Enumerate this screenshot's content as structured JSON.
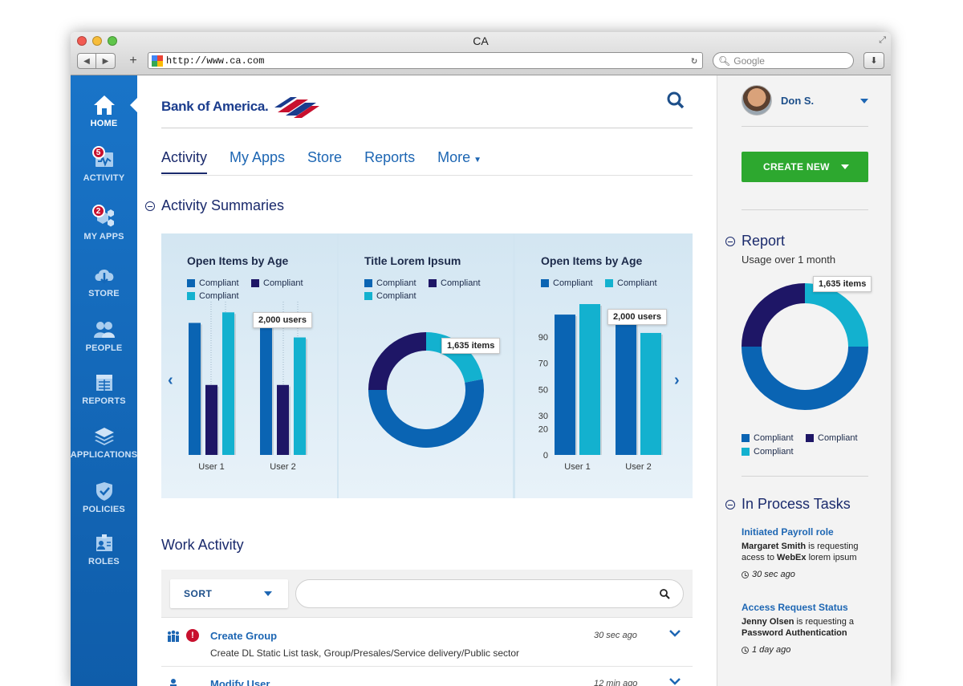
{
  "browser": {
    "window_title": "CA",
    "url": "http://www.ca.com",
    "search_placeholder": "Google"
  },
  "sidebar": {
    "items": [
      {
        "label": "HOME",
        "icon": "home-icon"
      },
      {
        "label": "ACTIVITY",
        "icon": "activity-icon",
        "badge": "5"
      },
      {
        "label": "MY APPS",
        "icon": "apps-icon",
        "badge": "2"
      },
      {
        "label": "STORE",
        "icon": "store-icon"
      },
      {
        "label": "PEOPLE",
        "icon": "people-icon"
      },
      {
        "label": "REPORTS",
        "icon": "reports-icon"
      },
      {
        "label": "APPLICATIONS",
        "icon": "applications-icon"
      },
      {
        "label": "POLICIES",
        "icon": "policies-icon"
      },
      {
        "label": "ROLES",
        "icon": "roles-icon"
      }
    ]
  },
  "header": {
    "logo_text": "Bank of America.",
    "tabs": [
      {
        "label": "Activity",
        "active": true
      },
      {
        "label": "My Apps"
      },
      {
        "label": "Store"
      },
      {
        "label": "Reports"
      },
      {
        "label": "More"
      }
    ]
  },
  "activity_summaries": {
    "title": "Activity Summaries"
  },
  "colors": {
    "dark_navy": "#1e1666",
    "royal_blue": "#0a64b3",
    "cyan": "#13b1cf",
    "accent_blue": "#1d66b3",
    "green": "#2da82f",
    "alert_red": "#c8102e"
  },
  "chart_data": [
    {
      "type": "bar",
      "title": "Open Items by Age",
      "legend": [
        "Compliant",
        "Compliant",
        "Compliant"
      ],
      "categories": [
        "User 1",
        "User 2"
      ],
      "series": [
        {
          "name": "Compliant",
          "color": "#0a64b3",
          "values": [
            100,
            100
          ]
        },
        {
          "name": "Compliant",
          "color": "#1e1666",
          "values": [
            53,
            53
          ]
        },
        {
          "name": "Compliant",
          "color": "#13b1cf",
          "values": [
            108,
            89
          ]
        }
      ],
      "ylim": [
        0,
        110
      ],
      "annotation": "2,000 users"
    },
    {
      "type": "pie",
      "title": "Title Lorem Ipsum",
      "legend": [
        "Compliant",
        "Compliant",
        "Compliant"
      ],
      "slices": [
        {
          "label": "Compliant",
          "color": "#13b1cf",
          "value": 22
        },
        {
          "label": "Compliant",
          "color": "#0a64b3",
          "value": 53
        },
        {
          "label": "Compliant",
          "color": "#1e1666",
          "value": 25
        }
      ],
      "annotation": "1,635 items"
    },
    {
      "type": "bar",
      "title": "Open Items by Age",
      "legend": [
        "Compliant",
        "Compliant"
      ],
      "categories": [
        "User 1",
        "User 2"
      ],
      "series": [
        {
          "name": "Compliant",
          "color": "#0a64b3",
          "values": [
            107,
            101
          ]
        },
        {
          "name": "Compliant",
          "color": "#13b1cf",
          "values": [
            115,
            93
          ]
        }
      ],
      "yticks": [
        0,
        20,
        30,
        50,
        70,
        90
      ],
      "ylim": [
        0,
        115
      ],
      "annotation": "2,000 users"
    },
    {
      "type": "pie",
      "title": "Report",
      "subtitle": "Usage over 1 month",
      "legend": [
        "Compliant",
        "Compliant",
        "Compliant"
      ],
      "slices": [
        {
          "label": "Compliant",
          "color": "#13b1cf",
          "value": 25
        },
        {
          "label": "Compliant",
          "color": "#0a64b3",
          "value": 50
        },
        {
          "label": "Compliant",
          "color": "#1e1666",
          "value": 25
        }
      ],
      "annotation": "1,635 items"
    }
  ],
  "work_activity": {
    "title": "Work Activity",
    "sort_label": "SORT",
    "rows": [
      {
        "title": "Create Group",
        "desc": "Create DL Static List task, Group/Presales/Service delivery/Public sector",
        "time": "30 sec ago",
        "alert": "!"
      },
      {
        "title": "Modify User",
        "desc": "",
        "time": "12 min ago"
      }
    ]
  },
  "right_panel": {
    "user_name": "Don S.",
    "create_label": "CREATE NEW",
    "report_title": "Report",
    "report_sub": "Usage over 1 month",
    "tasks_title": "In Process Tasks",
    "tasks": [
      {
        "title": "Initiated Payroll role",
        "name": "Margaret Smith",
        "mid": " is requesting acess to ",
        "target": "WebEx",
        "rest": " lorem ipsum",
        "time": "30 sec ago"
      },
      {
        "title": "Access Request Status",
        "name": "Jenny Olsen",
        "mid": " is requesting a ",
        "target": "Password Authentication",
        "rest": "",
        "time": "1 day ago"
      }
    ]
  }
}
